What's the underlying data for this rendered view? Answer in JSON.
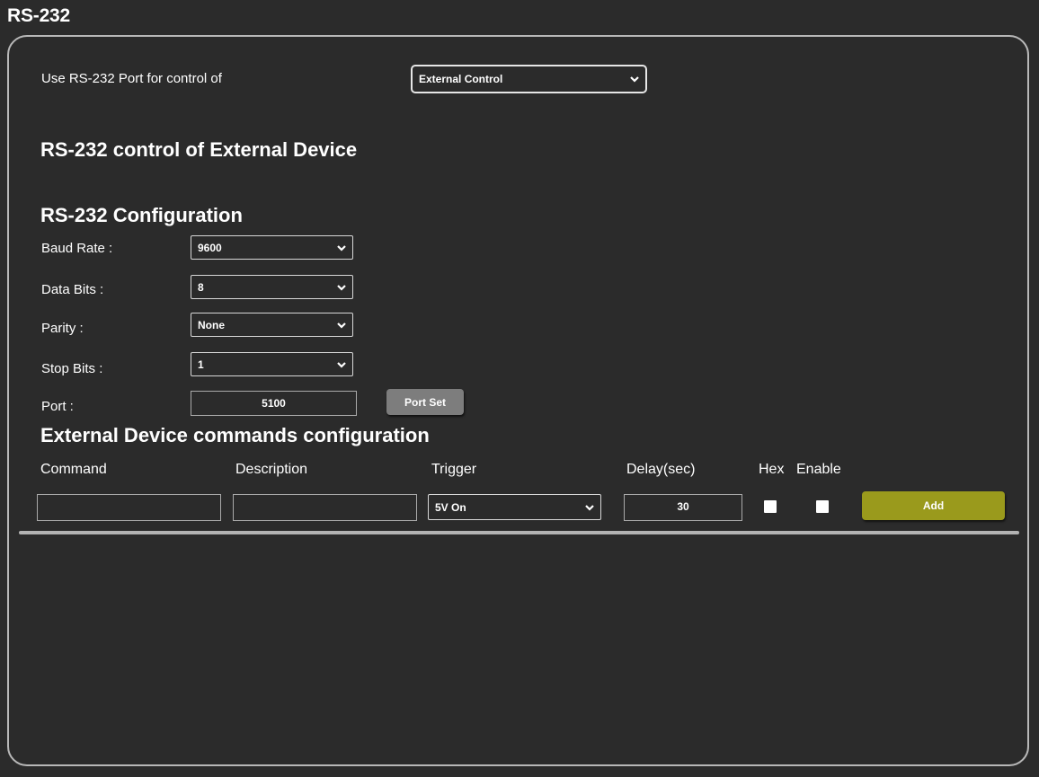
{
  "page": {
    "title": "RS-232"
  },
  "port_usage": {
    "label": "Use RS-232 Port for control of",
    "selected": "External Control"
  },
  "sections": {
    "external_control_title": "RS-232 control of External Device",
    "configuration_title": "RS-232 Configuration",
    "commands_title": "External Device commands configuration"
  },
  "configuration": {
    "baud_rate": {
      "label": "Baud Rate :",
      "value": "9600"
    },
    "data_bits": {
      "label": "Data Bits :",
      "value": "8"
    },
    "parity": {
      "label": "Parity :",
      "value": "None"
    },
    "stop_bits": {
      "label": "Stop Bits :",
      "value": "1"
    },
    "port": {
      "label": "Port :",
      "value": "5100",
      "button_label": "Port Set"
    }
  },
  "commands": {
    "headers": {
      "command": "Command",
      "description": "Description",
      "trigger": "Trigger",
      "delay": "Delay(sec)",
      "hex": "Hex",
      "enable": "Enable"
    },
    "new_row": {
      "command": "",
      "description": "",
      "trigger": "5V On",
      "delay": "30",
      "hex_checked": false,
      "enable_checked": false,
      "add_label": "Add"
    }
  },
  "colors": {
    "background": "#2b2b2b",
    "panel_border": "#b8b8b8",
    "add_button": "#9a9a1c",
    "port_set_button": "#7d7d7d"
  },
  "icons": {
    "dropdown": "chevron-down-icon"
  }
}
